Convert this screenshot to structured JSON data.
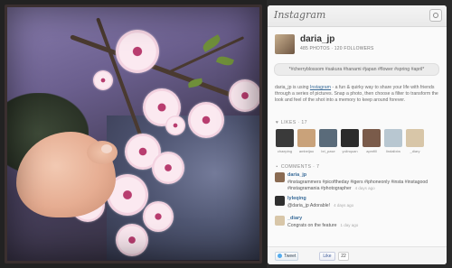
{
  "header": {
    "logo": "Instagram",
    "camera_icon": "camera-icon"
  },
  "user": {
    "name": "daria_jp",
    "stats": "485 PHOTOS · 120 FOLLOWERS"
  },
  "hashtags": "*#cherryblossom #sakura #hanami #japan #flower #spring #april*",
  "description": {
    "before": "daria_jp is using ",
    "link": "Instagram",
    "after": " - a fun & quirky way to share your life with friends through a series of pictures. Snap a photo, then choose a filter to transform the look and feel of the shot into a memory to keep around forever."
  },
  "likes": {
    "title": "LIKES",
    "count": "17",
    "users": [
      {
        "name": "chaeping",
        "color": "#3a3a3a"
      },
      {
        "name": "ambeijao",
        "color": "#c9a27a"
      },
      {
        "name": "bri_pase",
        "color": "#5a6b7a"
      },
      {
        "name": "yolinquan",
        "color": "#2c2c2c"
      },
      {
        "name": "apmfill",
        "color": "#7a5b4a"
      },
      {
        "name": "lindalixiw",
        "color": "#b8c7d1"
      },
      {
        "name": "_diary",
        "color": "#d8c6a8"
      }
    ]
  },
  "comments": {
    "title": "COMMENTS",
    "count": "7",
    "items": [
      {
        "user": "daria_jp",
        "text": "#instagrammers #picoftheday #igers #iphoneonly #insta #instagood #instagramania #photographer",
        "time": "4 days ago",
        "color": "#8a6b52"
      },
      {
        "user": "lyleqing",
        "text": "@daria_jp Adorable!",
        "time": "4 days ago",
        "color": "#2f2f2f"
      },
      {
        "user": "_diary",
        "text": "Congrats on the feature",
        "time": "1 day ago",
        "color": "#d8c6a8"
      }
    ]
  },
  "footer": {
    "tweet_label": "Tweet",
    "like_label": "Like",
    "like_count": "22"
  }
}
